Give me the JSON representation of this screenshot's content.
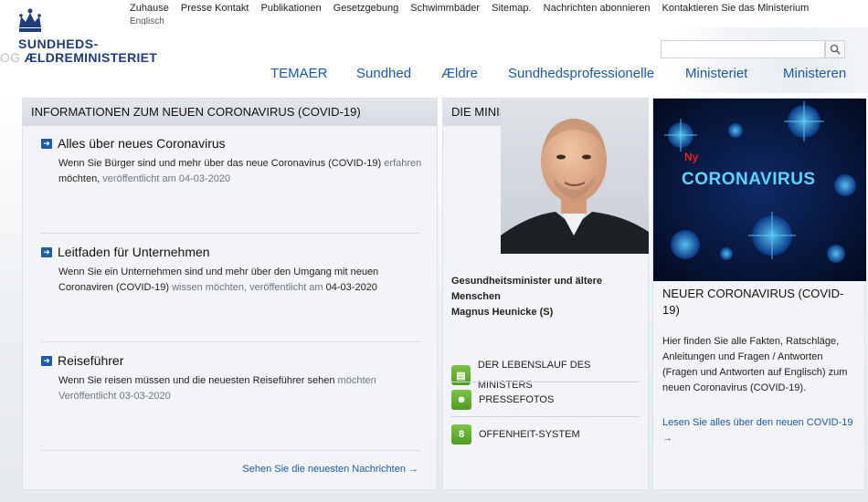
{
  "logo": {
    "line1": "SUNDHEDS-",
    "line2_faded": "OG ",
    "line2": "ÆLDREMINISTERIET",
    "icon": "crown-icon"
  },
  "top_nav": [
    "Zuhause",
    "Presse Kontakt",
    "Publikationen",
    "Gesetzgebung",
    "Schwimmbäder",
    "Sitemap.",
    "Nachrichten abonnieren",
    "Kontaktieren Sie das Ministerium"
  ],
  "top_nav_sub": "Englisch",
  "search": {
    "placeholder": "",
    "icon": "search-icon"
  },
  "main_nav": [
    "TEMAER",
    "Sundhed",
    "Ældre",
    "Sundhedsprofessionelle",
    "Ministeriet",
    "Ministeren"
  ],
  "news": {
    "header": "INFORMATIONEN ZUM NEUEN CORONAVIRUS (COVID-19)",
    "items": [
      {
        "title": "Alles über neues Coronavirus",
        "body_a": "Wenn Sie Bürger sind und mehr über das neue Coronavirus (COVID-19)",
        "body_muted1": " erfahren",
        "body_b": " möchten,",
        "body_muted2": "   veröffentlicht am 04-03-2020"
      },
      {
        "title": "Leitfaden für Unternehmen",
        "body_a": "Wenn Sie ein Unternehmen sind und mehr über den Umgang mit neuen Coronaviren (COVID-19)",
        "body_muted1": "  wissen möchten, veröffentlicht am",
        "body_b": " 04-03-2020",
        "body_muted2": ""
      },
      {
        "title": "Reiseführer",
        "body_a": "Wenn Sie reisen müssen und die neuesten Reiseführer sehen",
        "body_muted1": " möchten Veröffentlicht 03-03-2020",
        "body_b": "",
        "body_muted2": ""
      }
    ],
    "more_link": "Sehen Sie die neuesten Nachrichten →"
  },
  "minister": {
    "header": "DIE MINISTER",
    "role_line1": "Gesundheitsminister und ältere",
    "role_line2": "Menschen",
    "name": "Magnus Heunicke (S)",
    "links": [
      {
        "label": "DER LEBENSLAUF DES MINISTERS",
        "icon": "document-icon"
      },
      {
        "label": "PRESSEFOTOS",
        "icon": "people-icon"
      },
      {
        "label": "OFFENHEIT-SYSTEM",
        "icon": "calendar-icon"
      }
    ]
  },
  "covid": {
    "image_ny": "Ny",
    "image_title": "CORONAVIRUS",
    "title": "NEUER CORONAVIRUS (COVID-19)",
    "body": "Hier finden Sie alle Fakten, Ratschläge, Anleitungen und Fragen / Antworten (Fragen und Antworten auf Englisch) zum neuen Coronavirus (COVID-19).",
    "link": "Lesen Sie alles über den neuen COVID-19  →"
  },
  "colors": {
    "brand": "#1f3d7a",
    "link": "#1d5aa8",
    "green": "#5aa82a"
  }
}
